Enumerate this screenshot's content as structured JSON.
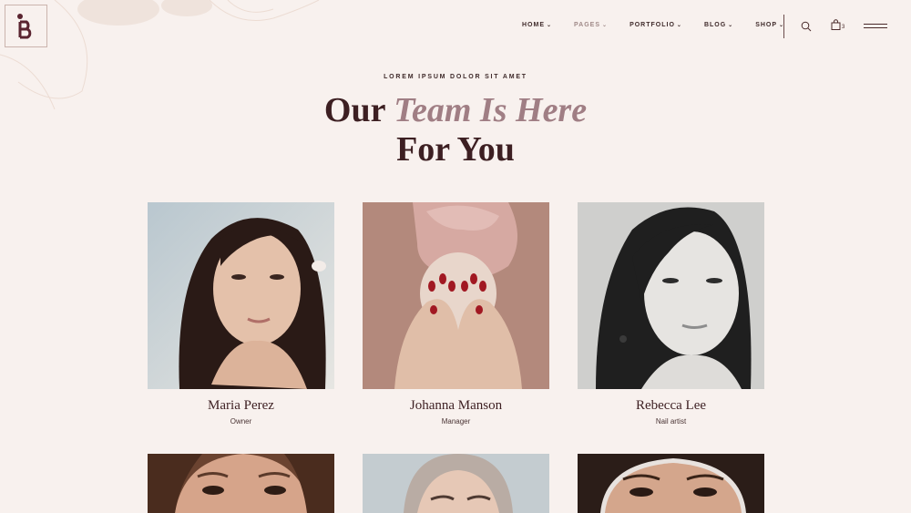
{
  "header": {
    "nav": [
      {
        "label": "HOME",
        "muted": false
      },
      {
        "label": "PAGES",
        "muted": true
      },
      {
        "label": "PORTFOLIO",
        "muted": false
      },
      {
        "label": "BLOG",
        "muted": false
      },
      {
        "label": "SHOP",
        "muted": false
      }
    ],
    "chevron": "⌄",
    "cart_count": "3"
  },
  "hero": {
    "eyebrow": "LOREM IPSUM DOLOR SIT AMET",
    "title_part1": "Our ",
    "title_accent": "Team Is Here",
    "title_line2": "For You"
  },
  "team": [
    {
      "name": "Maria Perez",
      "role": "Owner"
    },
    {
      "name": "Johanna Manson",
      "role": "Manager"
    },
    {
      "name": "Rebecca Lee",
      "role": "Nail artist"
    }
  ],
  "colors": {
    "background": "#f8f1ee",
    "accent": "#a07e84",
    "heading": "#3d1f22"
  }
}
